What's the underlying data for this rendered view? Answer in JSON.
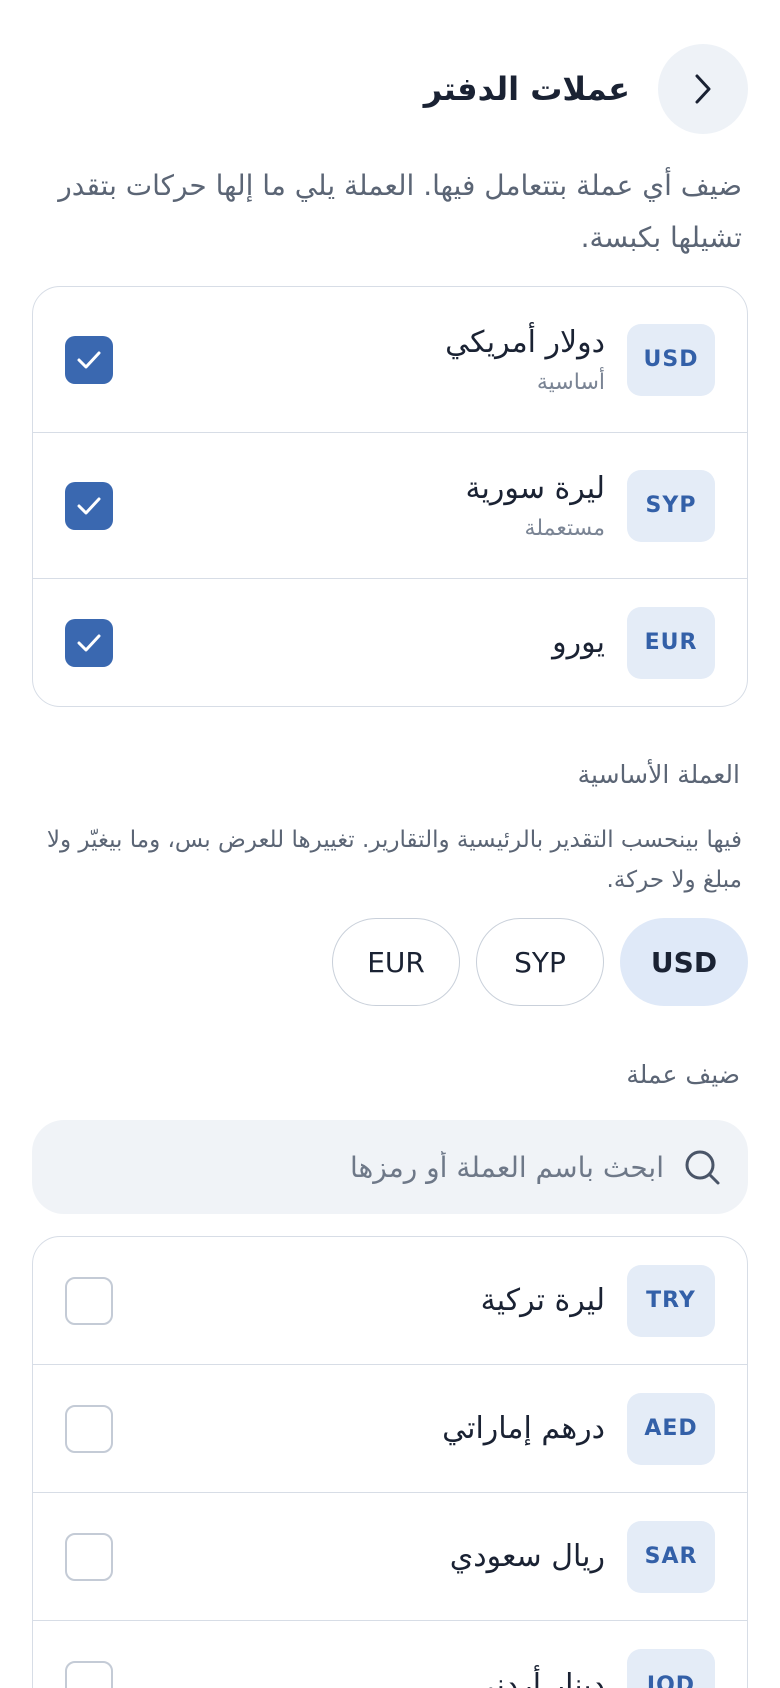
{
  "header": {
    "title": "عملات الدفتر"
  },
  "intro": "ضيف أي عملة بتتعامل فيها. العملة يلي ما إلها حركات بتقدر تشيلها بكبسة.",
  "active_currencies": [
    {
      "code": "USD",
      "name": "دولار أمريكي",
      "sub": "أساسية"
    },
    {
      "code": "SYP",
      "name": "ليرة سورية",
      "sub": "مستعملة"
    },
    {
      "code": "EUR",
      "name": "يورو",
      "sub": ""
    }
  ],
  "base_currency": {
    "label": "العملة الأساسية",
    "description": "فيها بينحسب التقدير بالرئيسية والتقارير. تغييرها للعرض بس، وما بيغيّر ولا مبلغ ولا حركة.",
    "options": [
      "USD",
      "SYP",
      "EUR"
    ],
    "selected": "USD"
  },
  "add_currency": {
    "label": "ضيف عملة",
    "search_placeholder": "ابحث باسم العملة أو رمزها",
    "search_value": ""
  },
  "available_currencies": [
    {
      "code": "TRY",
      "name": "ليرة تركية"
    },
    {
      "code": "AED",
      "name": "درهم إماراتي"
    },
    {
      "code": "SAR",
      "name": "ريال سعودي"
    },
    {
      "code": "JOD",
      "name": "دينار أردني"
    }
  ],
  "colors": {
    "accent": "#3a68b0",
    "badge_bg": "#e4ecf7",
    "badge_text": "#3360a8",
    "selected_pill": "#dfe9f8"
  },
  "icons": {
    "back": "chevron-right-icon",
    "check": "check-icon",
    "search": "search-icon"
  }
}
